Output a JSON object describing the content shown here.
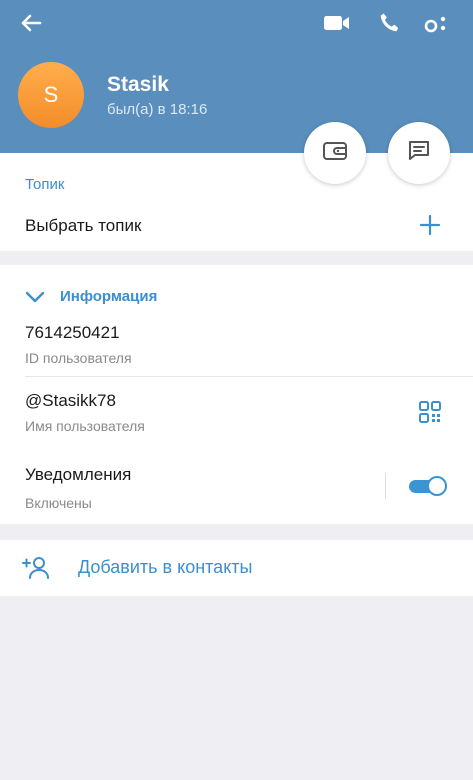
{
  "header": {
    "avatar_letter": "S",
    "name": "Stasik",
    "status": "был(а) в 18:16",
    "background_color": "#5a8fbd",
    "icons": [
      "back-arrow-icon",
      "video-call-icon",
      "phone-icon",
      "more-icon"
    ]
  },
  "fabs": [
    "wallet-icon",
    "message-icon"
  ],
  "topic": {
    "section_title": "Топик",
    "choose_label": "Выбрать топик"
  },
  "info": {
    "section_title": "Информация",
    "user_id": "7614250421",
    "user_id_label": "ID пользователя",
    "username": "@Stasikk78",
    "username_label": "Имя пользователя",
    "notifications": "Уведомления",
    "notifications_state": "Включены",
    "notifications_enabled": true
  },
  "actions": {
    "add_contact": "Добавить в контакты"
  },
  "colors": {
    "accent": "#3b8fcd",
    "avatar_gradient_top": "#ffae4d",
    "avatar_gradient_bottom": "#f58c2a",
    "background": "#efeff3"
  }
}
